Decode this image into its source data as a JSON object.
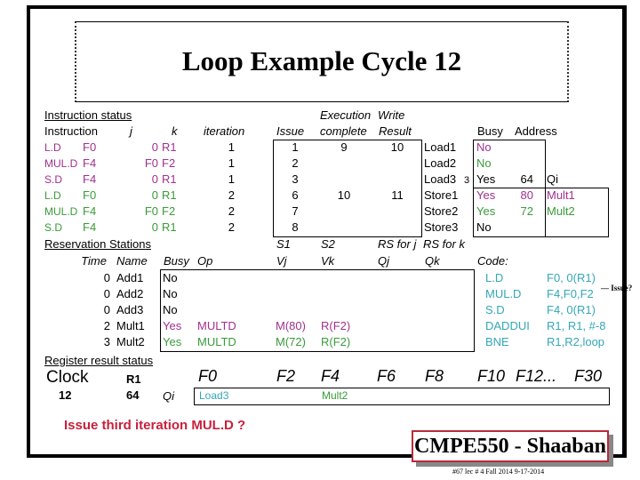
{
  "title": "Loop Example Cycle 12",
  "instruction_status": {
    "section_label": "Instruction status",
    "headers": {
      "instruction": "Instruction",
      "j": "j",
      "k": "k",
      "iteration": "iteration",
      "exec_top": "Execution",
      "write_top": "Write",
      "issue": "Issue",
      "complete": "complete",
      "result": "Result"
    },
    "rows": [
      {
        "op": "L.D",
        "dest": "F0",
        "j": "0",
        "k": "R1",
        "iteration": "1",
        "issue": "1",
        "exec": "9",
        "write": "10",
        "color": "mag"
      },
      {
        "op": "MUL.D",
        "dest": "F4",
        "j": "F0",
        "k": "F2",
        "iteration": "1",
        "issue": "2",
        "exec": "",
        "write": "",
        "color": "mag"
      },
      {
        "op": "S.D",
        "dest": "F4",
        "j": "0",
        "k": "R1",
        "iteration": "1",
        "issue": "3",
        "exec": "",
        "write": "",
        "color": "mag"
      },
      {
        "op": "L.D",
        "dest": "F0",
        "j": "0",
        "k": "R1",
        "iteration": "2",
        "issue": "6",
        "exec": "10",
        "write": "11",
        "color": "grn"
      },
      {
        "op": "MUL.D",
        "dest": "F4",
        "j": "F0",
        "k": "F2",
        "iteration": "2",
        "issue": "7",
        "exec": "",
        "write": "",
        "color": "grn"
      },
      {
        "op": "S.D",
        "dest": "F4",
        "j": "0",
        "k": "R1",
        "iteration": "2",
        "issue": "8",
        "exec": "",
        "write": "",
        "color": "grn"
      }
    ]
  },
  "load_store_buffers": {
    "headers": {
      "busy": "Busy",
      "address": "Address",
      "qi": "Qi"
    },
    "rows": [
      {
        "name": "Load1",
        "extra": "",
        "busy": "No",
        "address": "",
        "qi": "",
        "color": "mag"
      },
      {
        "name": "Load2",
        "extra": "",
        "busy": "No",
        "address": "",
        "qi": "",
        "color": "grn"
      },
      {
        "name": "Load3",
        "extra": "3",
        "busy": "Yes",
        "address": "64",
        "qi": "",
        "color": ""
      },
      {
        "name": "Store1",
        "extra": "",
        "busy": "Yes",
        "address": "80",
        "qi": "Mult1",
        "color": "mag"
      },
      {
        "name": "Store2",
        "extra": "",
        "busy": "Yes",
        "address": "72",
        "qi": "Mult2",
        "color": "grn"
      },
      {
        "name": "Store3",
        "extra": "",
        "busy": "No",
        "address": "",
        "qi": "",
        "color": ""
      }
    ]
  },
  "reservation_stations": {
    "section_label": "Reservation Stations",
    "headers": {
      "time": "Time",
      "name": "Name",
      "busy": "Busy",
      "op": "Op",
      "s1": "S1",
      "s2": "S2",
      "rs_j": "RS for j",
      "rs_k": "RS for k",
      "vj": "Vj",
      "vk": "Vk",
      "qj": "Qj",
      "qk": "Qk"
    },
    "rows": [
      {
        "time": "0",
        "name": "Add1",
        "busy": "No",
        "op": "",
        "vj": "",
        "vk": "",
        "qj": "",
        "qk": "",
        "color": ""
      },
      {
        "time": "0",
        "name": "Add2",
        "busy": "No",
        "op": "",
        "vj": "",
        "vk": "",
        "qj": "",
        "qk": "",
        "color": ""
      },
      {
        "time": "0",
        "name": "Add3",
        "busy": "No",
        "op": "",
        "vj": "",
        "vk": "",
        "qj": "",
        "qk": "",
        "color": ""
      },
      {
        "time": "2",
        "name": "Mult1",
        "busy": "Yes",
        "op": "MULTD",
        "vj": "M(80)",
        "vk": "R(F2)",
        "qj": "",
        "qk": "",
        "color": "mag"
      },
      {
        "time": "3",
        "name": "Mult2",
        "busy": "Yes",
        "op": "MULTD",
        "vj": "M(72)",
        "vk": "R(F2)",
        "qj": "",
        "qk": "",
        "color": "grn"
      }
    ]
  },
  "code": {
    "label": "Code:",
    "lines": [
      {
        "op": "L.D",
        "args": "F0, 0(R1)"
      },
      {
        "op": "MUL.D",
        "args": "F4,F0,F2"
      },
      {
        "op": "S.D",
        "args": "F4, 0(R1)"
      },
      {
        "op": "DADDUI",
        "args": "R1, R1, #-8"
      },
      {
        "op": "BNE",
        "args": "R1,R2,loop"
      }
    ],
    "annotation": "Issue?"
  },
  "register_status": {
    "section_label": "Register result status",
    "clock_label": "Clock",
    "clock_value": "12",
    "r1_label": "R1",
    "r1_value": "64",
    "qi_label": "Qi",
    "registers": [
      {
        "name": "F0",
        "qi": "Load3"
      },
      {
        "name": "F2",
        "qi": ""
      },
      {
        "name": "F4",
        "qi": "Mult2"
      },
      {
        "name": "F6",
        "qi": ""
      },
      {
        "name": "F8",
        "qi": ""
      },
      {
        "name": "F10",
        "qi": ""
      },
      {
        "name": "F12...",
        "qi": ""
      },
      {
        "name": "F30",
        "qi": ""
      }
    ]
  },
  "question": "Issue third iteration MUL.D ?",
  "footer": {
    "badge": "CMPE550 - Shaaban",
    "note": "#67  lec # 4 Fall 2014   9-17-2014"
  },
  "colors": {
    "iter1": "#a0308f",
    "iter2": "#3a9a3a",
    "code": "#35a7b8",
    "question": "#c8203c",
    "footer_border": "#b82a3a"
  }
}
